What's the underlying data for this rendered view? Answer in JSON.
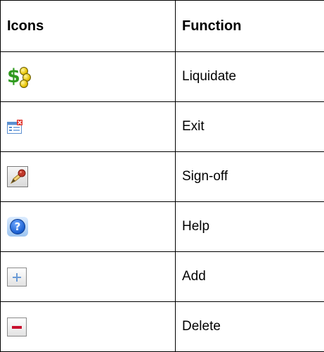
{
  "table": {
    "headers": {
      "icons": "Icons",
      "function": "Function"
    },
    "rows": [
      {
        "icon": "liquidate-icon",
        "function": "Liquidate"
      },
      {
        "icon": "exit-icon",
        "function": "Exit"
      },
      {
        "icon": "sign-off-icon",
        "function": "Sign-off"
      },
      {
        "icon": "help-icon",
        "function": "Help"
      },
      {
        "icon": "add-icon",
        "function": "Add"
      },
      {
        "icon": "delete-icon",
        "function": "Delete"
      }
    ]
  },
  "colors": {
    "border": "#000000",
    "dollar_green": "#2f9a1e",
    "coin_yellow": "#e8c200",
    "exit_red": "#e0322b",
    "help_blue": "#1a5fd0",
    "add_blue": "#6b9bd6",
    "delete_red": "#c8102e"
  }
}
